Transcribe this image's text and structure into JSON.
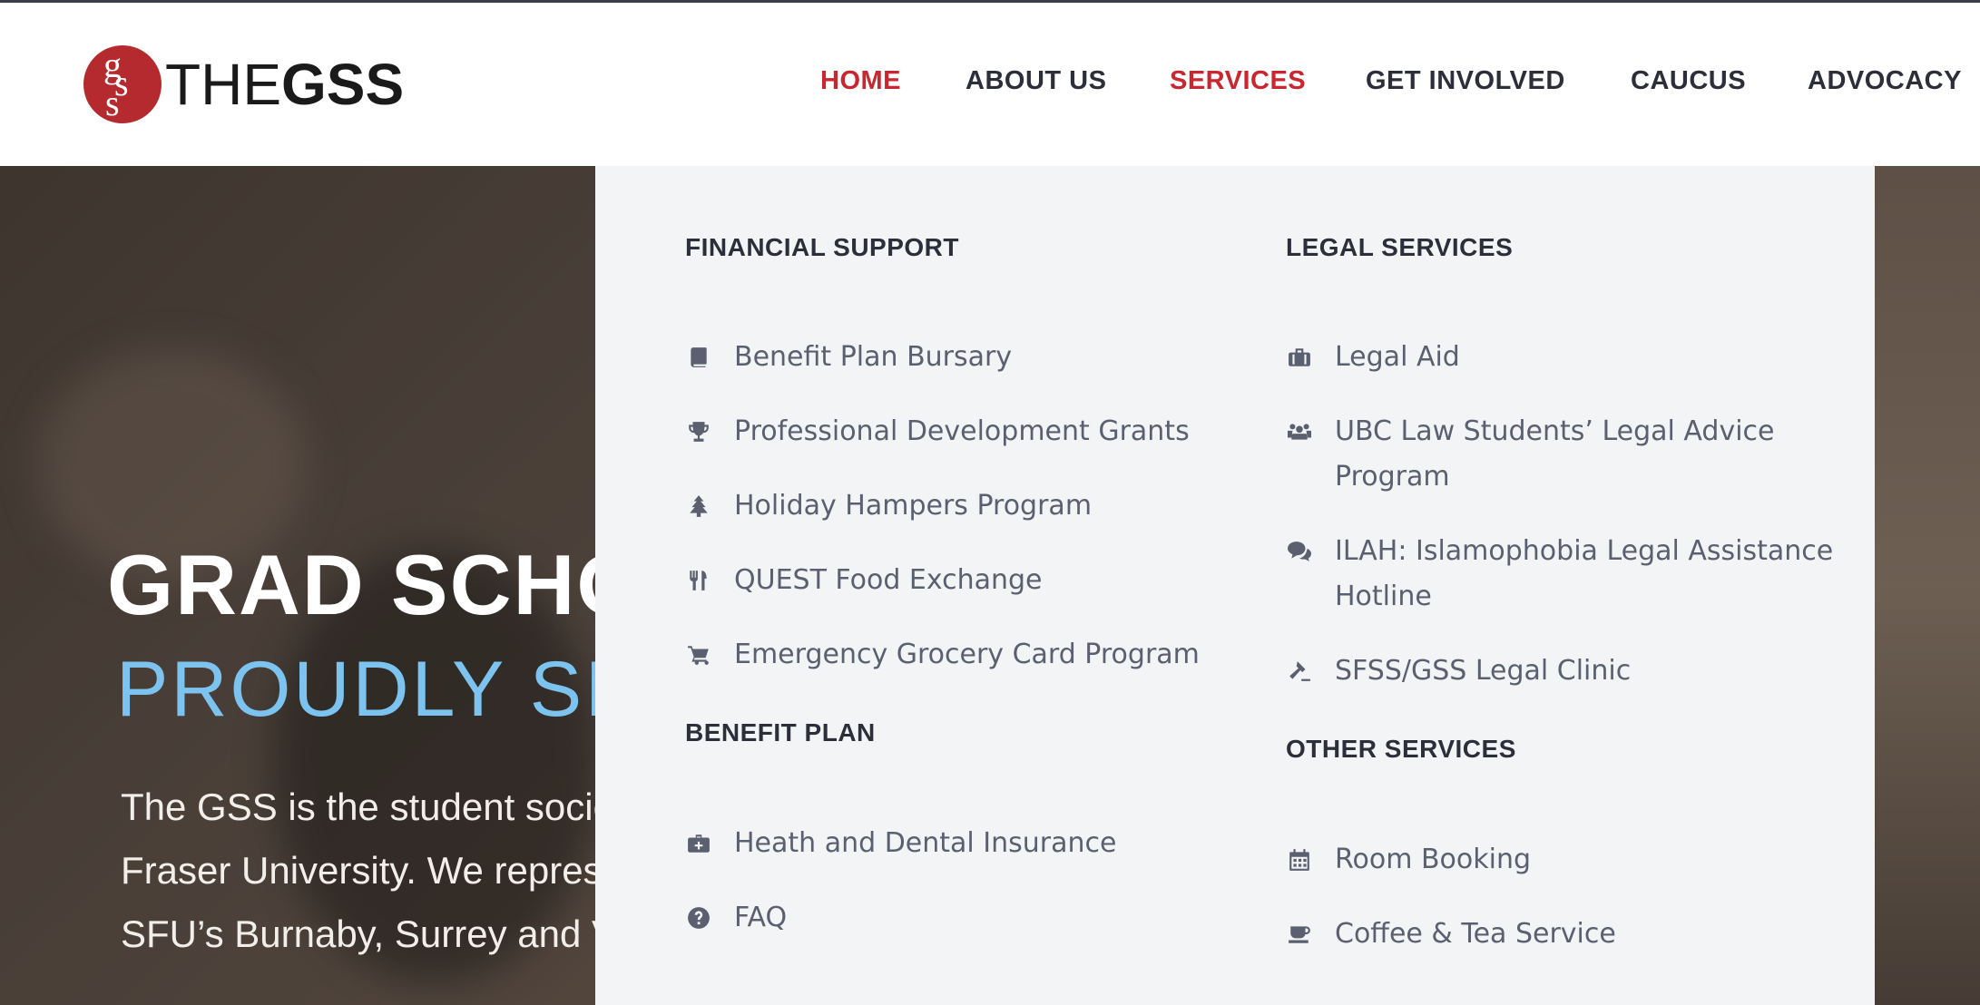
{
  "brand": {
    "monogram": "gss",
    "wordmark_light": "THE",
    "wordmark_bold": "GSS",
    "color": "#b52a2e"
  },
  "nav": {
    "items": [
      {
        "label": "HOME",
        "active": true
      },
      {
        "label": "ABOUT US",
        "active": false
      },
      {
        "label": "SERVICES",
        "active": true
      },
      {
        "label": "GET INVOLVED",
        "active": false
      },
      {
        "label": "CAUCUS",
        "active": false
      },
      {
        "label": "ADVOCACY",
        "active": false
      }
    ],
    "active_color": "#c9262f",
    "text_color": "#2c2f3a"
  },
  "hero": {
    "title": "GRAD SCHO",
    "subtitle": "PROUDLY SI",
    "subtitle_color": "#7cc4ef",
    "paragraph_lines": [
      "The GSS is the student socie",
      "Fraser University. We represe",
      "SFU’s Burnaby, Surrey and V"
    ]
  },
  "menu": {
    "financial_support": {
      "heading": "FINANCIAL SUPPORT",
      "items": [
        {
          "label": "Benefit Plan Bursary",
          "icon": "book-icon"
        },
        {
          "label": "Professional Development Grants",
          "icon": "trophy-icon"
        },
        {
          "label": "Holiday Hampers Program",
          "icon": "tree-icon"
        },
        {
          "label": "QUEST Food Exchange",
          "icon": "cutlery-icon"
        },
        {
          "label": "Emergency Grocery Card Program",
          "icon": "cart-icon"
        }
      ]
    },
    "benefit_plan": {
      "heading": "BENEFIT PLAN",
      "items": [
        {
          "label": "Heath and Dental Insurance",
          "icon": "medkit-icon"
        },
        {
          "label": "FAQ",
          "icon": "question-icon"
        }
      ]
    },
    "legal_services": {
      "heading": "LEGAL SERVICES",
      "items": [
        {
          "label": "Legal Aid",
          "icon": "briefcase-icon"
        },
        {
          "label_line1": "UBC Law Students’ Legal Advice",
          "label_line2": "Program",
          "icon": "users-icon"
        },
        {
          "label_line1": "ILAH: Islamophobia Legal Assistance",
          "label_line2": "Hotline",
          "icon": "comments-icon"
        },
        {
          "label": "SFSS/GSS Legal Clinic",
          "icon": "gavel-icon"
        }
      ]
    },
    "other_services": {
      "heading": "OTHER SERVICES",
      "items": [
        {
          "label": "Room Booking",
          "icon": "calendar-icon"
        },
        {
          "label": "Coffee & Tea Service",
          "icon": "coffee-icon"
        }
      ]
    }
  }
}
